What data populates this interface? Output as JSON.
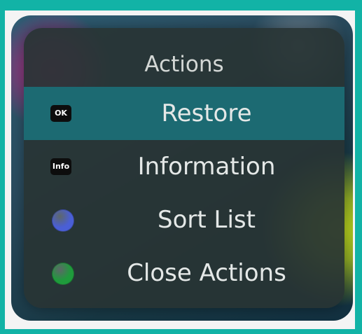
{
  "menu": {
    "title": "Actions",
    "items": [
      {
        "key": "OK",
        "label": "Restore",
        "selected": true
      },
      {
        "key": "Info",
        "label": "Information",
        "selected": false
      },
      {
        "key_color": "#4a5fd6",
        "key_name": "blue-button-icon",
        "label": "Sort List",
        "selected": false
      },
      {
        "key_color": "#1f9b3c",
        "key_name": "green-button-icon",
        "label": "Close Actions",
        "selected": false
      }
    ]
  }
}
